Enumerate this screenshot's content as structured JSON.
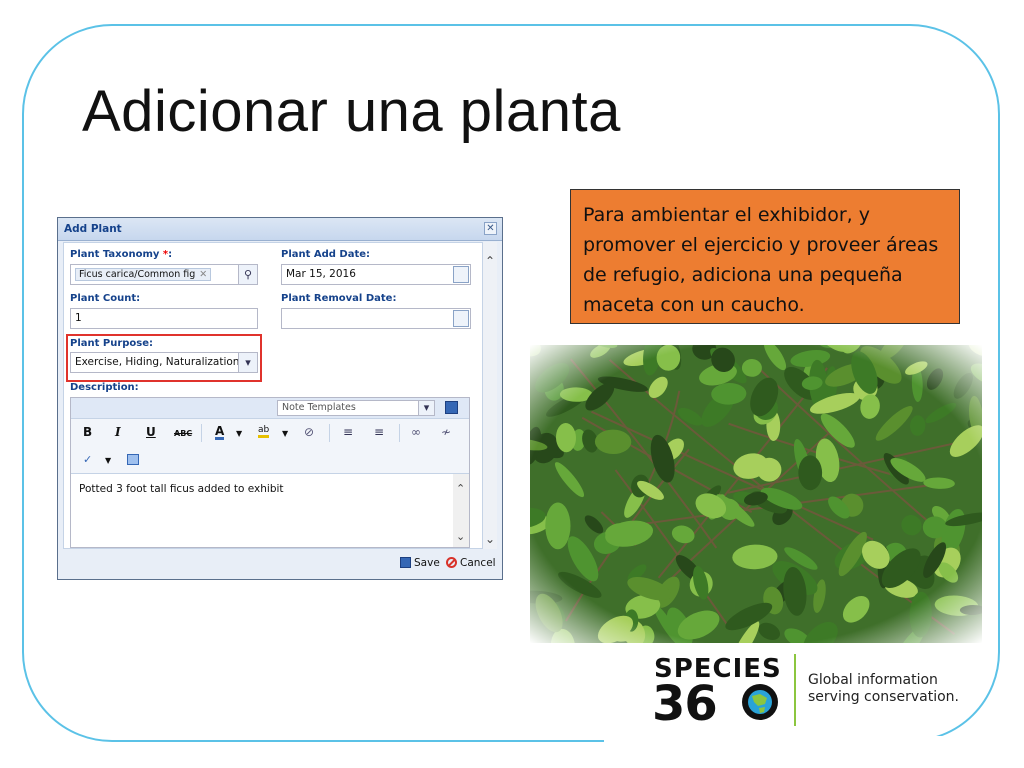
{
  "slide": {
    "title": "Adicionar una planta",
    "callout": "Para ambientar el exhibidor, y promover el ejercicio y proveer áreas de refugio, adiciona una pequeña maceta con un caucho."
  },
  "dialog": {
    "title": "Add Plant",
    "close_icon": "✕",
    "taxonomy": {
      "label": "Plant Taxonomy ",
      "required_mark": "*",
      "colon": ":",
      "tag": "Ficus carica/Common fig",
      "tag_remove": "✕"
    },
    "add_date": {
      "label": "Plant Add Date:",
      "value": "Mar 15, 2016"
    },
    "count": {
      "label": "Plant Count:",
      "value": "1"
    },
    "removal_date": {
      "label": "Plant Removal Date:",
      "value": ""
    },
    "purpose": {
      "label": "Plant Purpose:",
      "value": "Exercise, Hiding, Naturalization"
    },
    "description": {
      "label": "Description:",
      "note_templates_placeholder": "Note Templates",
      "toolbar": {
        "bold": "B",
        "italic": "I",
        "underline": "U",
        "strike": "ABC",
        "font_color": "A",
        "highlight": "ab"
      },
      "text": "Potted 3 foot tall ficus added to exhibit"
    },
    "footer": {
      "save_label": "Save",
      "cancel_label": "Cancel"
    }
  },
  "logo": {
    "word": "SPECIES",
    "number": "36",
    "tagline_1": "Global information",
    "tagline_2": "serving conservation."
  },
  "colors": {
    "frame": "#5bc2e7",
    "callout_bg": "#ed7d31",
    "highlight_box": "#e0332c",
    "logo_accent": "#8cc63f"
  }
}
